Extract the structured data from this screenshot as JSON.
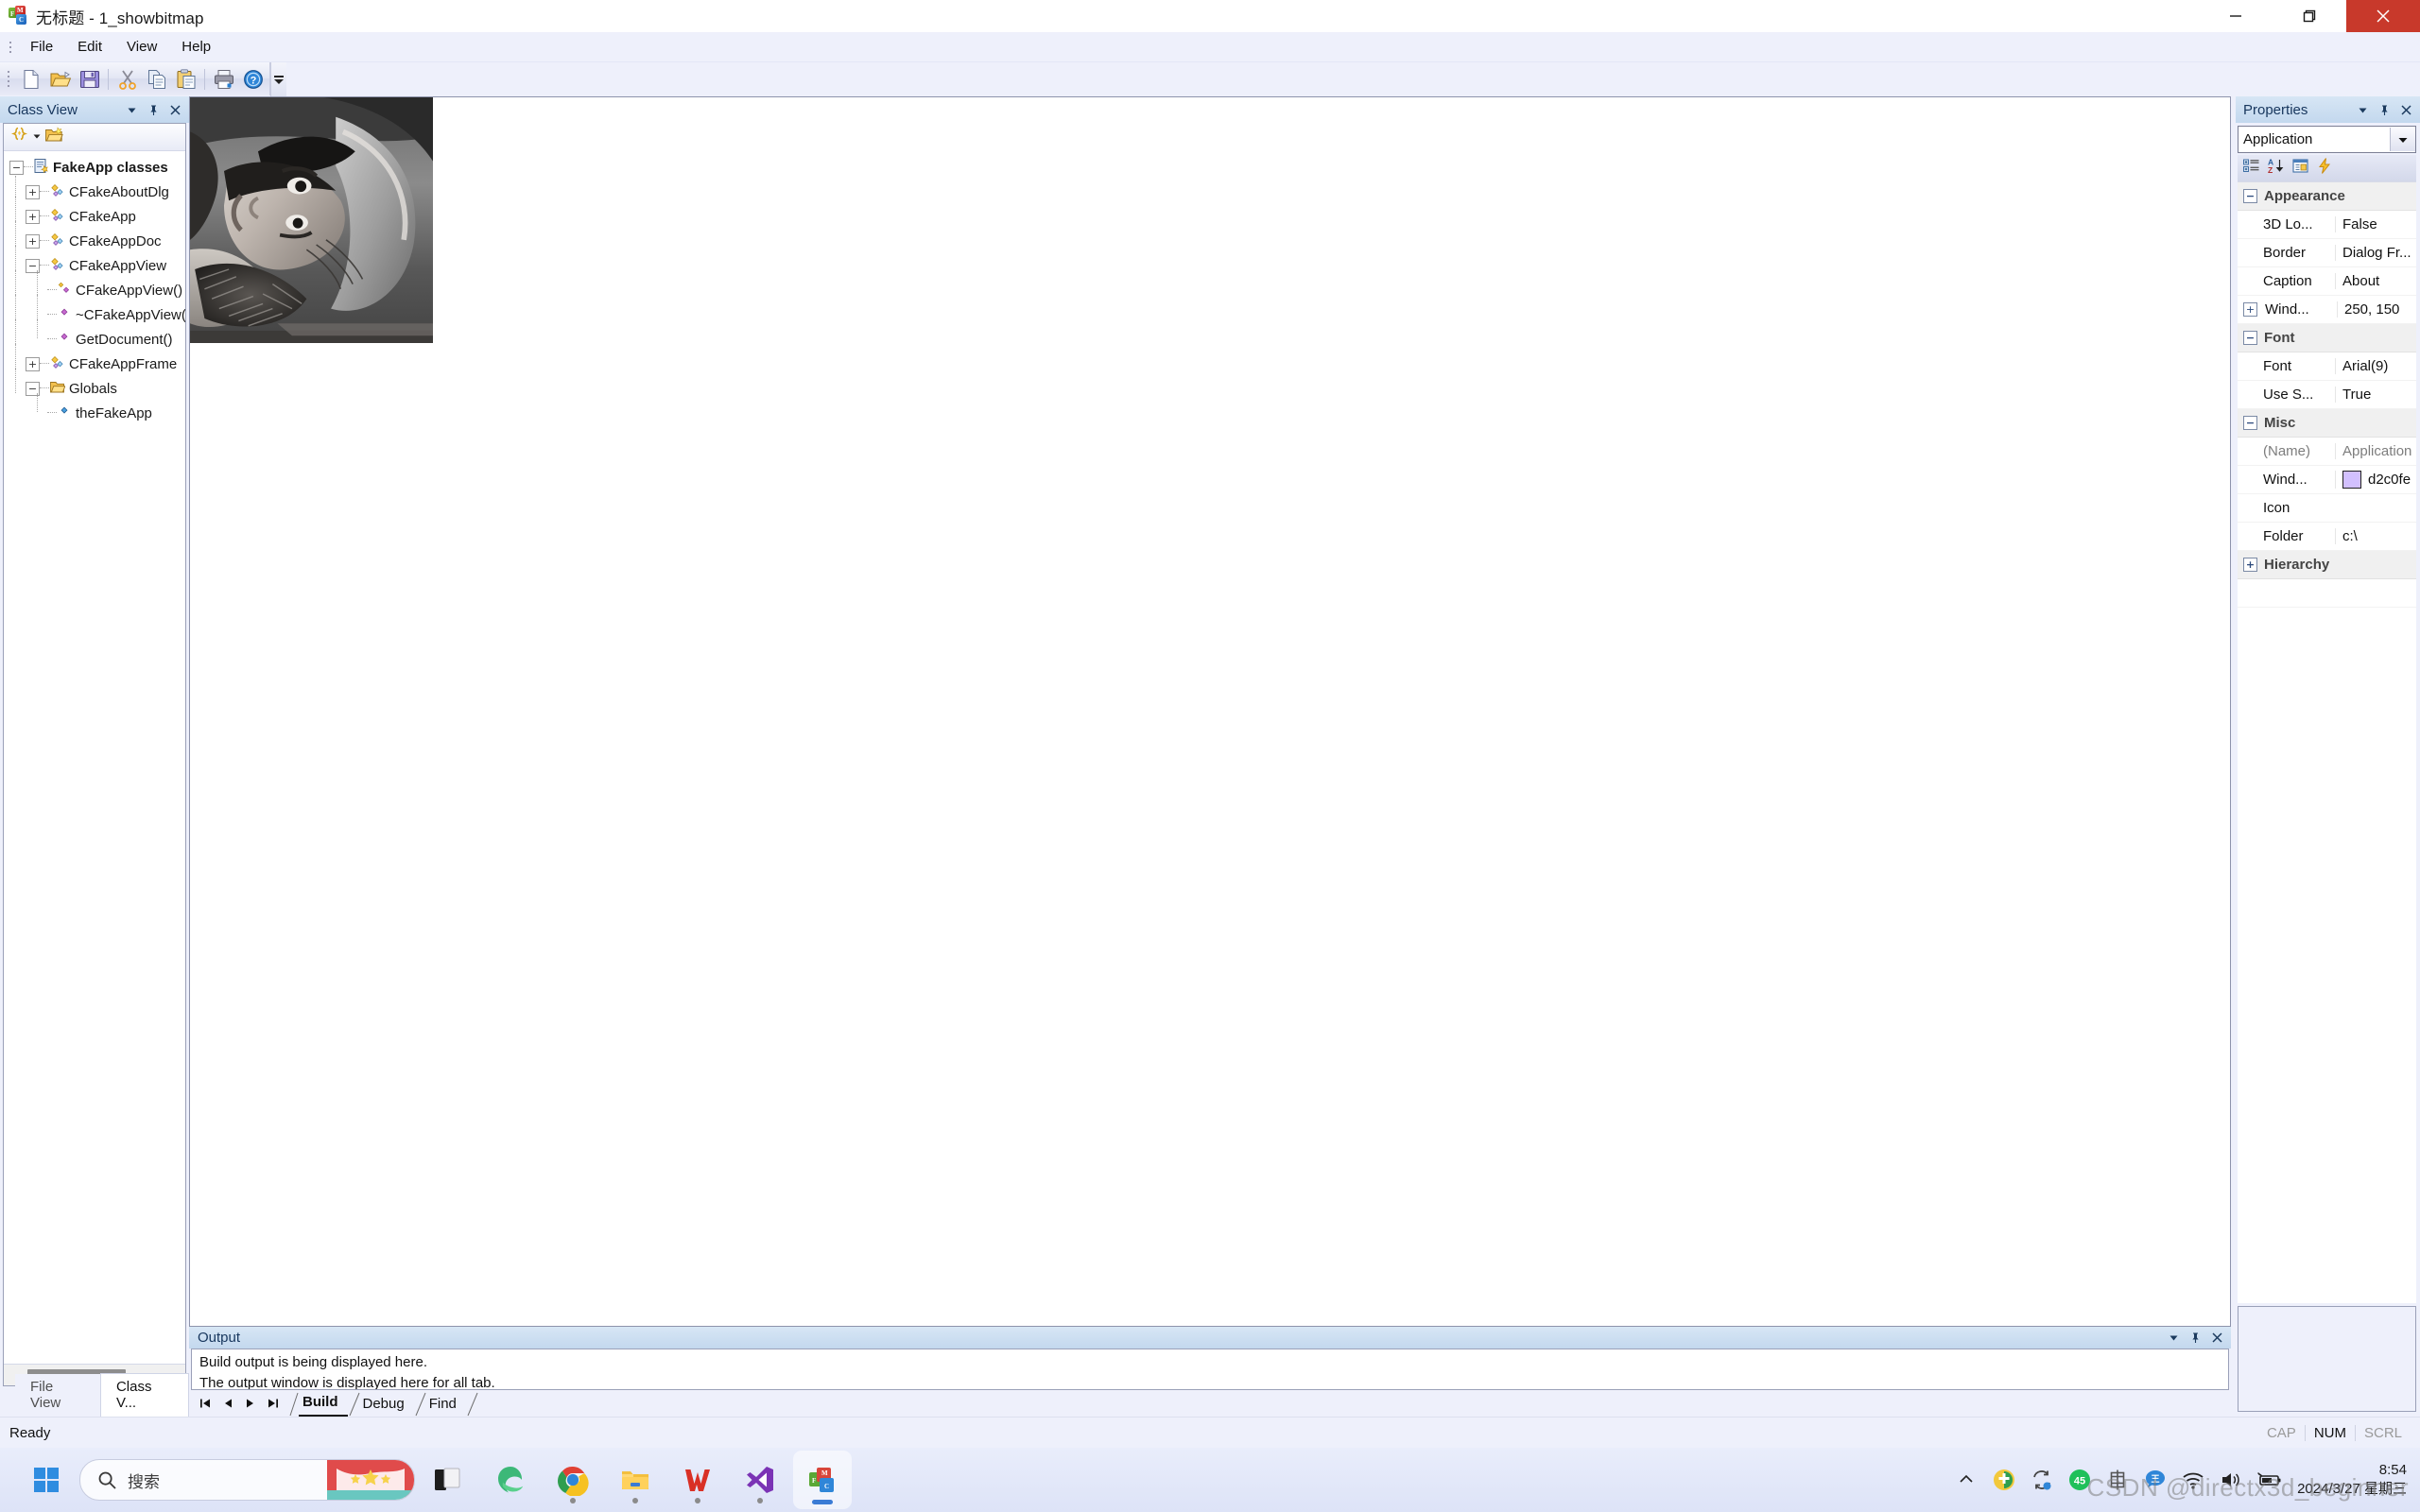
{
  "window": {
    "title": "无标题 - 1_showbitmap",
    "app_icon": "mfc-app-icon",
    "controls": {
      "minimize": "Minimize",
      "restore": "Restore",
      "close": "Close"
    }
  },
  "menubar": {
    "items": [
      "File",
      "Edit",
      "View",
      "Help"
    ]
  },
  "toolbar": {
    "buttons": [
      {
        "name": "new-document",
        "label": "New"
      },
      {
        "name": "open-folder",
        "label": "Open"
      },
      {
        "name": "save-disk",
        "label": "Save"
      },
      {
        "name": "separator",
        "label": ""
      },
      {
        "name": "cut-scissors",
        "label": "Cut"
      },
      {
        "name": "copy-pages",
        "label": "Copy"
      },
      {
        "name": "paste-clipboard",
        "label": "Paste"
      },
      {
        "name": "separator",
        "label": ""
      },
      {
        "name": "print-printer",
        "label": "Print"
      },
      {
        "name": "help-question",
        "label": "About"
      }
    ],
    "overflow": "Toolbar Options"
  },
  "class_view": {
    "panel_title": "Class View",
    "panel_buttons": [
      "dropdown",
      "pin",
      "close"
    ],
    "toolbar": [
      "class-sort-icon",
      "chevron-down-icon",
      "new-folder-icon"
    ],
    "tree": [
      {
        "label": "FakeApp classes",
        "depth": 0,
        "expander": "-",
        "icon": "project-icon",
        "bold": true
      },
      {
        "label": "CFakeAboutDlg",
        "depth": 1,
        "expander": "+",
        "icon": "class-icon",
        "bold": false
      },
      {
        "label": "CFakeApp",
        "depth": 1,
        "expander": "+",
        "icon": "class-icon",
        "bold": false
      },
      {
        "label": "CFakeAppDoc",
        "depth": 1,
        "expander": "+",
        "icon": "class-icon",
        "bold": false
      },
      {
        "label": "CFakeAppView",
        "depth": 1,
        "expander": "-",
        "icon": "class-icon",
        "bold": false
      },
      {
        "label": "CFakeAppView()",
        "depth": 2,
        "expander": "",
        "icon": "method-protected-icon",
        "bold": false
      },
      {
        "label": "~CFakeAppView()",
        "depth": 2,
        "expander": "",
        "icon": "method-icon",
        "bold": false
      },
      {
        "label": "GetDocument()",
        "depth": 2,
        "expander": "",
        "icon": "method-icon",
        "bold": false
      },
      {
        "label": "CFakeAppFrame",
        "depth": 1,
        "expander": "+",
        "icon": "class-icon",
        "bold": false
      },
      {
        "label": "Globals",
        "depth": 1,
        "expander": "-",
        "icon": "folder-icon",
        "bold": false
      },
      {
        "label": "theFakeApp",
        "depth": 2,
        "expander": "",
        "icon": "variable-icon",
        "bold": false
      }
    ],
    "dock_tabs": [
      {
        "label": "File View",
        "active": false
      },
      {
        "label": "Class V...",
        "active": true
      }
    ]
  },
  "document": {
    "image_name": "lena-grayscale-bitmap",
    "alt": "Grayscale Lena test bitmap rotated 90 degrees"
  },
  "output": {
    "panel_title": "Output",
    "panel_buttons": [
      "dropdown",
      "pin",
      "close"
    ],
    "lines": [
      "Build output is being displayed here.",
      "The output window is displayed here for all tab."
    ],
    "nav_buttons": [
      "first",
      "previous",
      "next",
      "last"
    ],
    "tabs": [
      {
        "label": "Build",
        "active": true
      },
      {
        "label": "Debug",
        "active": false
      },
      {
        "label": "Find",
        "active": false
      }
    ]
  },
  "properties": {
    "panel_title": "Properties",
    "panel_buttons": [
      "dropdown",
      "pin",
      "close"
    ],
    "object_selector": "Application",
    "toolbar": [
      "categorized-icon",
      "alphabetic-sort-icon",
      "property-pages-icon",
      "events-icon"
    ],
    "rows": [
      {
        "type": "category",
        "expander": "-",
        "name": "Appearance",
        "value": ""
      },
      {
        "type": "prop",
        "expander": "",
        "name": "3D Lo...",
        "value": "False"
      },
      {
        "type": "prop",
        "expander": "",
        "name": "Border",
        "value": "Dialog Fr..."
      },
      {
        "type": "prop",
        "expander": "",
        "name": "Caption",
        "value": "About"
      },
      {
        "type": "prop",
        "expander": "+",
        "name": "Wind...",
        "value": "250, 150"
      },
      {
        "type": "category",
        "expander": "-",
        "name": "Font",
        "value": ""
      },
      {
        "type": "prop",
        "expander": "",
        "name": "Font",
        "value": "Arial(9)"
      },
      {
        "type": "prop",
        "expander": "",
        "name": "Use S...",
        "value": "True"
      },
      {
        "type": "category",
        "expander": "-",
        "name": "Misc",
        "value": ""
      },
      {
        "type": "prop",
        "expander": "",
        "name": "(Name)",
        "value": "Application",
        "dim": true
      },
      {
        "type": "prop",
        "expander": "",
        "name": "Wind...",
        "value": "d2c0fe",
        "swatch": "#d2c0fe"
      },
      {
        "type": "prop",
        "expander": "",
        "name": "Icon",
        "value": ""
      },
      {
        "type": "prop",
        "expander": "",
        "name": "Folder",
        "value": "c:\\"
      },
      {
        "type": "category",
        "expander": "+",
        "name": "Hierarchy",
        "value": ""
      }
    ]
  },
  "statusbar": {
    "message": "Ready",
    "indicators": [
      {
        "label": "CAP",
        "active": false
      },
      {
        "label": "NUM",
        "active": true
      },
      {
        "label": "SCRL",
        "active": false
      }
    ]
  },
  "taskbar": {
    "start": "start-windows-icon",
    "search_placeholder": "搜索",
    "items": [
      {
        "name": "task-view-icon",
        "running": false,
        "pinned": false
      },
      {
        "name": "edge-browser-icon",
        "running": false,
        "pinned": false
      },
      {
        "name": "chrome-browser-icon",
        "running": true,
        "pinned": false
      },
      {
        "name": "file-explorer-icon",
        "running": true,
        "pinned": false
      },
      {
        "name": "wps-office-icon",
        "running": true,
        "pinned": false
      },
      {
        "name": "visual-studio-icon",
        "running": true,
        "pinned": false
      },
      {
        "name": "mfc-app-icon",
        "running": true,
        "pinned": true
      }
    ],
    "tray": [
      "show-hidden-icons-chevron",
      "antivirus-shield-icon",
      "sync-arrows-icon",
      "speed-badge-45-icon",
      "ime-chinese-icon",
      "wangwang-icon",
      "wifi-icon",
      "volume-icon",
      "battery-charging-icon"
    ],
    "clock": {
      "time": "8:54",
      "date": "2024/3/27 星期三"
    }
  },
  "watermark": "CSDN @directx3d_beginner"
}
